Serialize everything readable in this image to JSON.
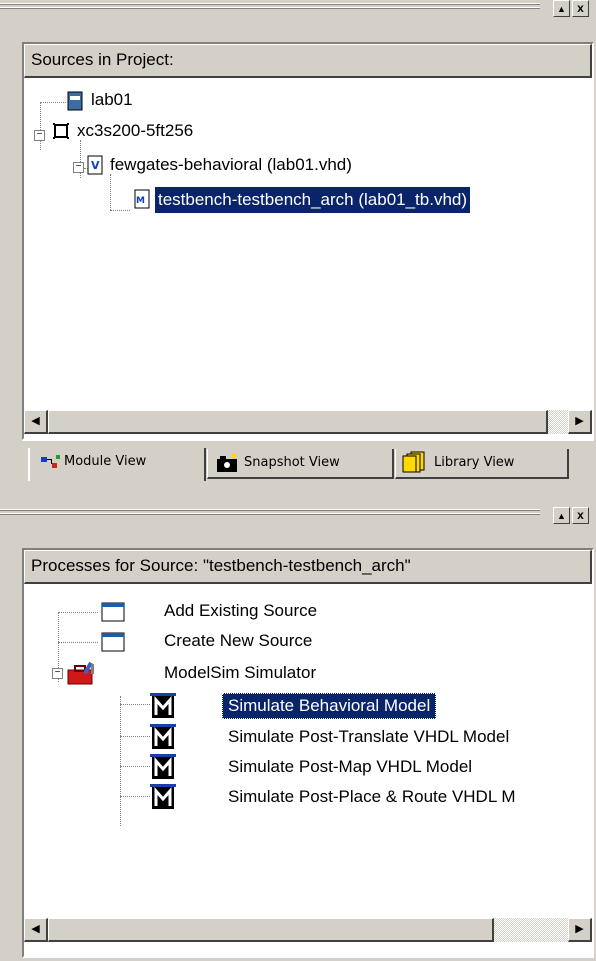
{
  "window_controls": {
    "restore_glyph": "▲",
    "close_glyph": "x"
  },
  "sources": {
    "header": "Sources in Project:",
    "items": [
      {
        "label": "lab01"
      },
      {
        "label": "xc3s200-5ft256"
      },
      {
        "label": "fewgates-behavioral (lab01.vhd)"
      },
      {
        "label": "testbench-testbench_arch (lab01_tb.vhd)"
      }
    ],
    "expander_glyph": "−"
  },
  "tabs": [
    {
      "label": "Module View"
    },
    {
      "label": "Snapshot View"
    },
    {
      "label": "Library View"
    }
  ],
  "processes": {
    "header": "Processes for Source:  \"testbench-testbench_arch\"",
    "items": [
      {
        "label": "Add Existing Source"
      },
      {
        "label": "Create New Source"
      },
      {
        "label": "ModelSim Simulator"
      },
      {
        "label": "Simulate Behavioral Model"
      },
      {
        "label": "Simulate Post-Translate VHDL Model"
      },
      {
        "label": "Simulate Post-Map VHDL Model"
      },
      {
        "label": "Simulate Post-Place & Route VHDL M"
      }
    ]
  },
  "scroll": {
    "left_glyph": "◀",
    "right_glyph": "▶"
  },
  "colors": {
    "selection": "#0a246a",
    "chrome": "#d4d0c8"
  }
}
